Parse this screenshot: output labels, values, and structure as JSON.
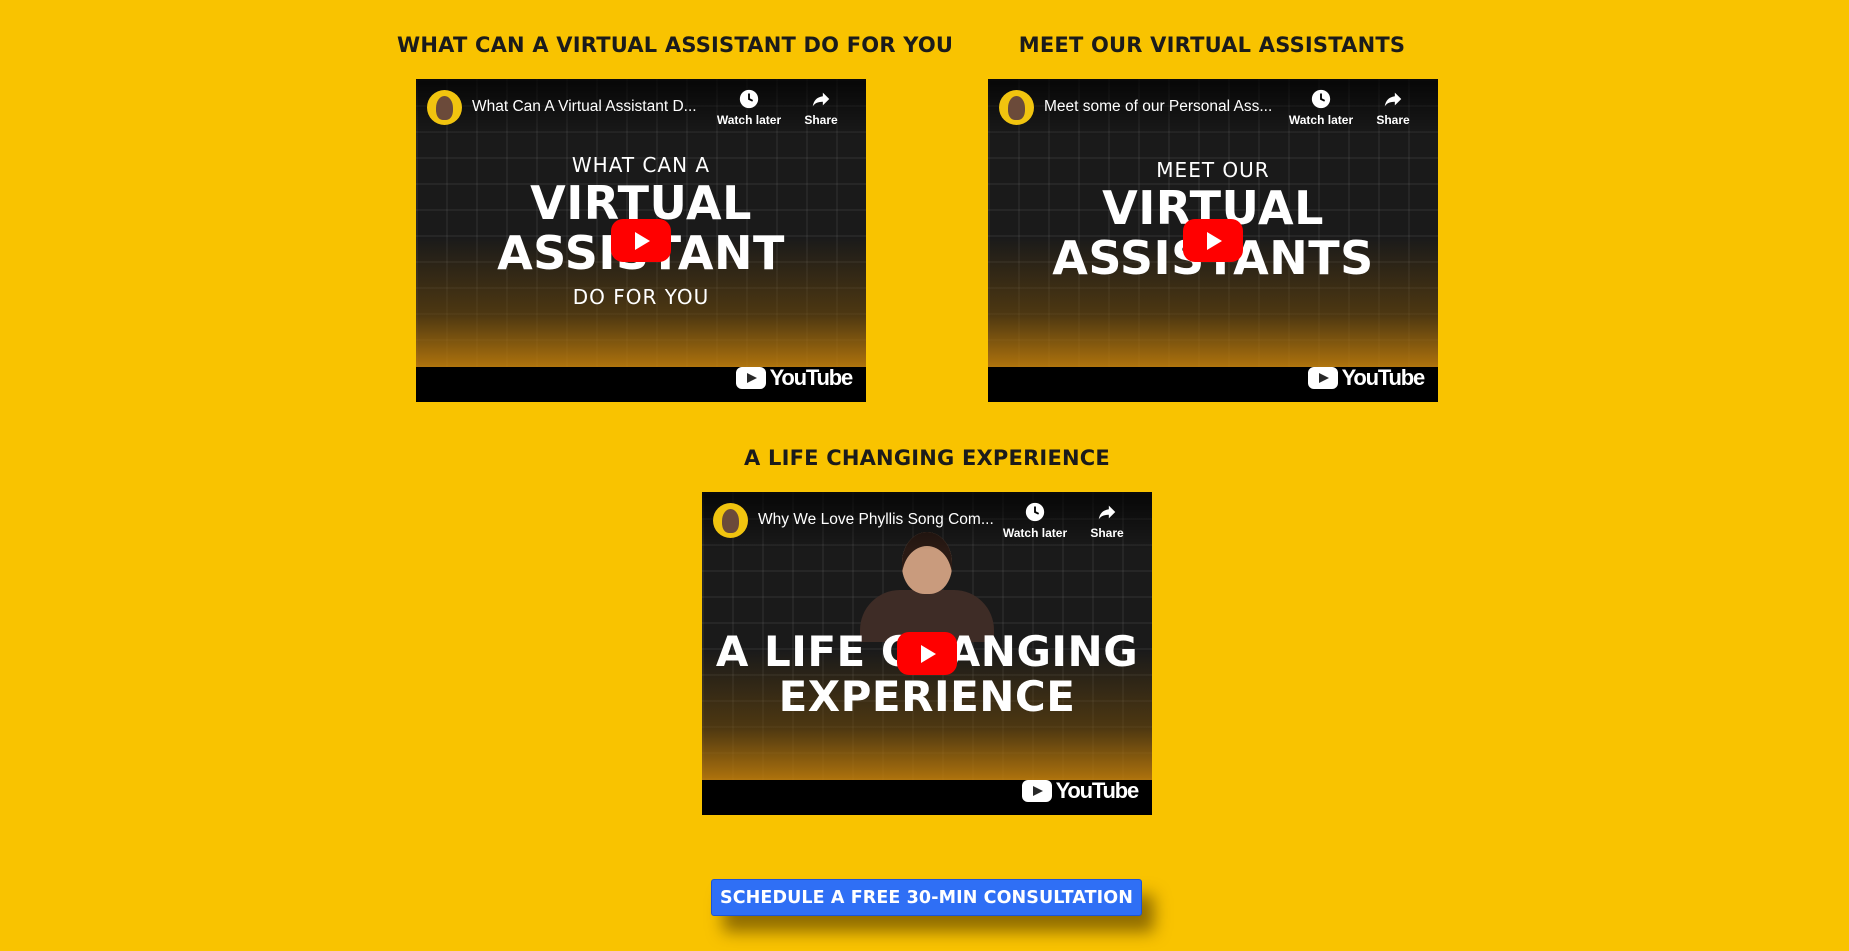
{
  "sections": [
    {
      "heading": "WHAT CAN A VIRTUAL ASSISTANT DO FOR YOU",
      "video": {
        "title": "What Can A Virtual Assistant D...",
        "thumb_line1": "WHAT CAN A",
        "thumb_line2": "VIRTUAL",
        "thumb_line3": "ASSISTANT",
        "thumb_line4": "DO FOR YOU"
      }
    },
    {
      "heading": "MEET OUR VIRTUAL ASSISTANTS",
      "video": {
        "title": "Meet some of our Personal Ass...",
        "thumb_line1": "MEET OUR",
        "thumb_line2": "VIRTUAL",
        "thumb_line3": "ASSISTANTS"
      }
    },
    {
      "heading": "A LIFE CHANGING EXPERIENCE",
      "video": {
        "title": "Why We Love Phyllis Song Com...",
        "thumb_line1": "A LIFE CHANGING",
        "thumb_line2": "EXPERIENCE"
      }
    }
  ],
  "player": {
    "watch_later_label": "Watch later",
    "share_label": "Share",
    "youtube_wordmark": "YouTube"
  },
  "cta": {
    "label": "SCHEDULE A FREE 30-MIN CONSULTATION"
  },
  "colors": {
    "background": "#f9c300",
    "cta": "#2f6ff5",
    "play_button": "#ff0000"
  }
}
